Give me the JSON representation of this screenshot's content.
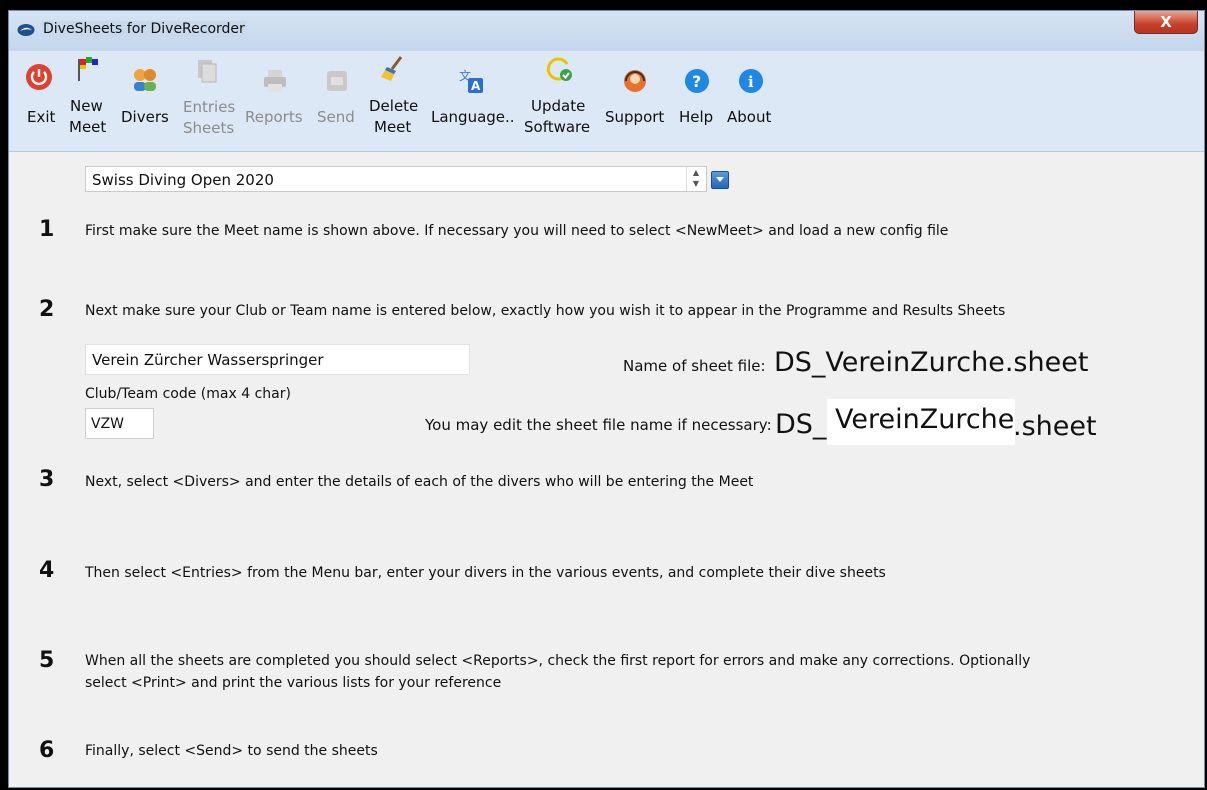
{
  "window": {
    "title": "DiveSheets for DiveRecorder",
    "close_label": "X"
  },
  "toolbar": {
    "items": [
      {
        "id": "exit",
        "line1": "",
        "line2": "Exit",
        "icon": "power-icon",
        "enabled": true
      },
      {
        "id": "new-meet",
        "line1": "New",
        "line2": "Meet",
        "icon": "flags-icon",
        "enabled": true
      },
      {
        "id": "divers",
        "line1": "",
        "line2": "Divers",
        "icon": "people-icon",
        "enabled": true
      },
      {
        "id": "entries-sheets",
        "line1": "Entries",
        "line2": "Sheets",
        "icon": "documents-icon",
        "enabled": false
      },
      {
        "id": "reports",
        "line1": "",
        "line2": "Reports",
        "icon": "printer-icon",
        "enabled": false
      },
      {
        "id": "send",
        "line1": "",
        "line2": "Send",
        "icon": "send-icon",
        "enabled": false
      },
      {
        "id": "delete-meet",
        "line1": "Delete",
        "line2": "Meet",
        "icon": "broom-icon",
        "enabled": true
      },
      {
        "id": "language",
        "line1": "",
        "line2": "Language..",
        "icon": "translate-icon",
        "enabled": true
      },
      {
        "id": "update-software",
        "line1": "Update",
        "line2": "Software",
        "icon": "refresh-check-icon",
        "enabled": true
      },
      {
        "id": "support",
        "line1": "",
        "line2": "Support",
        "icon": "headset-icon",
        "enabled": true
      },
      {
        "id": "help",
        "line1": "",
        "line2": "Help",
        "icon": "question-icon",
        "enabled": true
      },
      {
        "id": "about",
        "line1": "",
        "line2": "About",
        "icon": "info-icon",
        "enabled": true
      }
    ]
  },
  "meet": {
    "selected": "Swiss Diving Open 2020"
  },
  "steps": {
    "s1": {
      "num": "1",
      "text": "First make sure the Meet name is shown above.  If necessary you will need to select <NewMeet> and load a new config file"
    },
    "s2": {
      "num": "2",
      "text": "Next make sure your Club or Team name is entered below, exactly how you wish it to appear in the Programme and Results Sheets"
    },
    "s3": {
      "num": "3",
      "text": "Next, select <Divers> and enter the details of each of the divers who will be entering the Meet"
    },
    "s4": {
      "num": "4",
      "text": "Then select <Entries> from the Menu bar, enter your divers in the various events, and complete their dive sheets"
    },
    "s5": {
      "num": "5",
      "text_line1": "When all the sheets are completed you should select <Reports>, check the first report for errors and make any corrections.  Optionally",
      "text_line2": "select <Print> and print the various lists for your reference"
    },
    "s6": {
      "num": "6",
      "text": "Finally, select <Send> to send the sheets"
    }
  },
  "club": {
    "name": "Verein Zürcher Wasserspringer",
    "code_label": "Club/Team code (max 4 char)",
    "code": "VZW"
  },
  "sheet": {
    "name_label": "Name of sheet file:",
    "file_name": "DS_VereinZurche.sheet",
    "edit_label": "You may edit the sheet file name if necessary:",
    "prefix": "DS_",
    "editable_part": "VereinZurche",
    "suffix": ".sheet"
  },
  "colors": {
    "toolbar_bg": "#dce8f5",
    "window_bg": "#f0f0f0",
    "close_red": "#c7402a"
  }
}
